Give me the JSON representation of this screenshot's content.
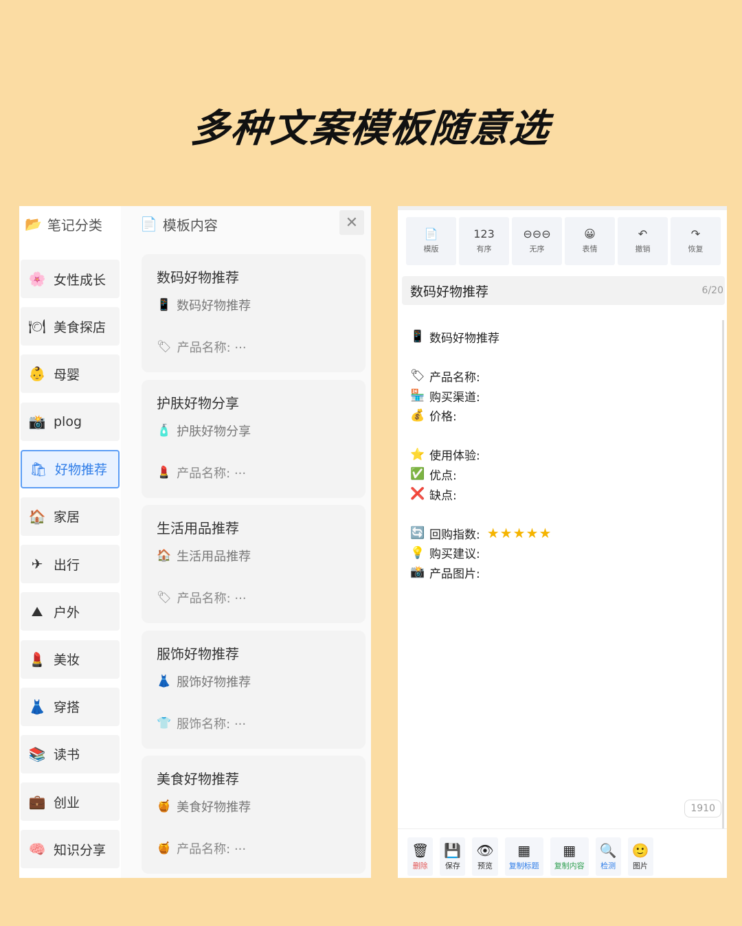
{
  "headline": "多种文案模板随意选",
  "categories": {
    "header": {
      "icon": "📂",
      "label": "笔记分类"
    },
    "items": [
      {
        "icon": "🌸",
        "label": "女性成长"
      },
      {
        "icon": "🍽",
        "label": "美食探店"
      },
      {
        "icon": "👶",
        "label": "母婴"
      },
      {
        "icon": "📸",
        "label": "plog"
      },
      {
        "icon": "🛍",
        "label": "好物推荐",
        "active": true
      },
      {
        "icon": "🏠",
        "label": "家居"
      },
      {
        "icon": "✈",
        "label": "出行"
      },
      {
        "icon": "⛰",
        "label": "户外"
      },
      {
        "icon": "💄",
        "label": "美妆"
      },
      {
        "icon": "👗",
        "label": "穿搭"
      },
      {
        "icon": "📚",
        "label": "读书"
      },
      {
        "icon": "💼",
        "label": "创业"
      },
      {
        "icon": "🧠",
        "label": "知识分享"
      }
    ]
  },
  "templates": {
    "header": {
      "icon": "📄",
      "label": "模板内容",
      "close": "✕"
    },
    "cards": [
      {
        "title": "数码好物推荐",
        "line_icon": "📱",
        "line": "数码好物推荐",
        "field_icon": "🏷",
        "field": "产品名称: ···"
      },
      {
        "title": "护肤好物分享",
        "line_icon": "🧴",
        "line": "护肤好物分享",
        "field_icon": "💄",
        "field": "产品名称: ···"
      },
      {
        "title": "生活用品推荐",
        "line_icon": "🏠",
        "line": "生活用品推荐",
        "field_icon": "🏷",
        "field": "产品名称: ···"
      },
      {
        "title": "服饰好物推荐",
        "line_icon": "👗",
        "line": "服饰好物推荐",
        "field_icon": "👕",
        "field": "服饰名称: ···"
      },
      {
        "title": "美食好物推荐",
        "line_icon": "🍯",
        "line": "美食好物推荐",
        "field_icon": "🍯",
        "field": "产品名称: ···"
      }
    ]
  },
  "editor": {
    "toolbar": [
      {
        "icon": "📄",
        "label": "模版",
        "name": "template"
      },
      {
        "icon": "123",
        "label": "有序",
        "name": "ordered"
      },
      {
        "icon": "⊖⊖⊖",
        "label": "无序",
        "name": "unordered"
      },
      {
        "icon": "😀",
        "label": "表情",
        "name": "emoji"
      },
      {
        "icon": "↶",
        "label": "撤销",
        "name": "undo"
      },
      {
        "icon": "↷",
        "label": "恢复",
        "name": "redo"
      }
    ],
    "title": "数码好物推荐",
    "title_count": "6/20",
    "body": [
      {
        "icon": "📱",
        "text": "数码好物推荐"
      },
      {
        "gap": true
      },
      {
        "icon": "🏷",
        "text": "产品名称:"
      },
      {
        "icon": "🏪",
        "text": "购买渠道:"
      },
      {
        "icon": "💰",
        "text": "价格:"
      },
      {
        "gap": true
      },
      {
        "icon": "⭐",
        "text": "使用体验:"
      },
      {
        "icon": "✅",
        "text": "优点:"
      },
      {
        "icon": "❌",
        "text": "缺点:"
      },
      {
        "gap": true
      },
      {
        "icon": "🔄",
        "text": "回购指数:",
        "stars": "★★★★★"
      },
      {
        "icon": "💡",
        "text": "购买建议:"
      },
      {
        "icon": "📸",
        "text": "产品图片:"
      }
    ],
    "char_count": "1910",
    "bottom_bar": [
      {
        "icon": "🗑",
        "label": "删除",
        "color": "#e25555",
        "name": "delete"
      },
      {
        "icon": "💾",
        "label": "保存",
        "color": "#333333",
        "name": "save"
      },
      {
        "icon": "👁",
        "label": "预览",
        "color": "#333333",
        "name": "preview"
      },
      {
        "icon": "▦",
        "label": "复制标题",
        "color": "#2f7de8",
        "name": "copy-title"
      },
      {
        "icon": "▦",
        "label": "复制内容",
        "color": "#2e9e4f",
        "name": "copy-content"
      },
      {
        "icon": "🔍",
        "label": "检测",
        "color": "#2f7de8",
        "name": "check"
      },
      {
        "icon": "🙂",
        "label": "图片",
        "color": "#333333",
        "name": "image"
      }
    ]
  }
}
